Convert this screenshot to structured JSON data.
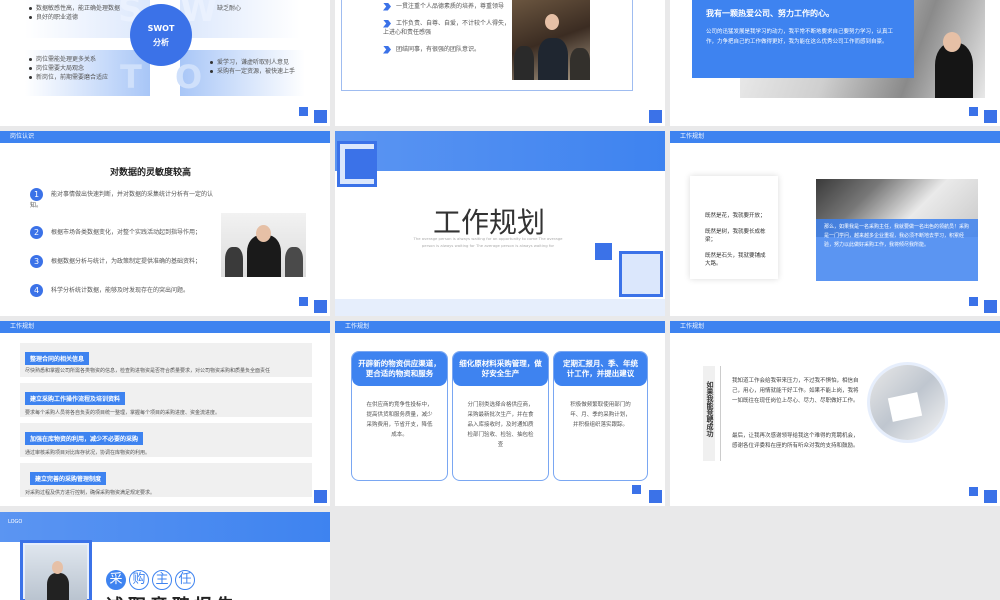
{
  "colors": {
    "accent": "#3e83f0",
    "dark_accent": "#3b72e8",
    "bg": "#e9e9ea"
  },
  "s1": {
    "tl": [
      "数据敏感性高，能正确处理数据",
      "良好的职业道德"
    ],
    "tr": [
      "缺乏耐心"
    ],
    "bl": [
      "岗位需能处理更多关系",
      "岗位需要大局观念",
      "新岗位，前期需要磨合适应"
    ],
    "br": [
      "爱学习，谦虚听取别人意见",
      "采购有一定资源，被快速上手"
    ],
    "center_line1": "SWOT",
    "center_line2": "分析",
    "letter_s": "S",
    "letter_w": "W",
    "letter_t": "T",
    "letter_o": "O"
  },
  "s2": {
    "items": [
      "一贯注重个人品德素质的培养，尊重领导",
      "工作负责、自尊、自爱，不计较个人得失，上进心和责任感强",
      "团结同事，有很强的团队意识。"
    ]
  },
  "s3": {
    "title": "我有一颗热爱公司、努力工作的心。",
    "body": "公司的迅猛发展是我学习的动力，我平常不断地要求自己要努力学习，认真工作，力争把自己的工作做得更好，我为能在这么优秀公司工作而感到自豪。"
  },
  "s4": {
    "tag": "岗位认识",
    "title": "对数据的灵敏度较高",
    "items": [
      {
        "n": "1",
        "t": "能对事情做出快速判断，并对数据的采集统计分析有一定的认知。"
      },
      {
        "n": "2",
        "t": "根据市场各类数据变化，对整个实践活动起到指导作用；"
      },
      {
        "n": "3",
        "t": "根据数据分析与统计，为政策制定提供准确的基础资料；"
      },
      {
        "n": "4",
        "t": "科学分析统计数据，能够及时发现存在的突出问题。"
      }
    ]
  },
  "s5": {
    "title": "工作规划",
    "sub": "The average person is always waiting for an opportunity to come The average person is always waiting for The average person is always waiting for"
  },
  "s6": {
    "tag": "工作规划",
    "lines": [
      "既然是花，我就要开放；",
      "既然是树，我就要长成栋梁；",
      "既然是石头，我就要铺成大路。"
    ],
    "overlay": "那么，如果我是一名采购主任，我就要做一名出色的领航员！采购是一门学问，越来越多企业重视，我必须不断地去学习，积累经验，努力以此做好采购工作，我将倾尽我所能。"
  },
  "s7": {
    "tag": "工作规划",
    "blocks": [
      {
        "h": "整理合同的相关信息",
        "b": "尽快熟悉和掌握公司所需各类物资的信息，检查购进物资是否符合质量要求，对公司物资采购和质量负全面责任"
      },
      {
        "h": "建立采购工作操作流程及培训资料",
        "b": "要求每个采购人员将各自负责的项目统一整理，掌握每个项目的采购进度、资金流进度。"
      },
      {
        "h": "加强在库物资的利用，减少不必要的采购",
        "b": "通过审核采购项目对比库存状况，协调在库物资的利用。"
      },
      {
        "h": "建立完善的采购管理制度",
        "b": "对采购过程及供方进行控制，确保采购物资满足规定要求。"
      }
    ]
  },
  "s8": {
    "tag": "工作规划",
    "cards": [
      {
        "h": "开辟新的物资供应渠道，更合适的物资和服务",
        "b": "在供应商的竞争性投标中，提高供货和服务质量，减少采购费用，节省开支，降低成本。"
      },
      {
        "h": "细化原材料采购管理，做好安全生产",
        "b": "分门别类选择合格供应商，采购最新批次生产，并在食品入库接收时，及时通知质检部门验收、检验、抽包检查"
      },
      {
        "h": "定期汇报月、季、年统计工作，并提出建议",
        "b": "积极做频繁取使用部门的年、月、季的采购计划，并积极组织落实跟踪。"
      }
    ]
  },
  "s9": {
    "tag": "工作规划",
    "vertical": "如果我能竞聘成功",
    "p1": "我知道工作会给我带来压力，不过我不惧怕，相信自己，用心，用情就能干好工作。如果不能上岗，我将一如既往在现任岗位上尽心、尽力、尽职做好工作。",
    "p2": "最后，让我再次感谢领导给我这个难得的竞聘机会，感谢各位评委和在座的所有听众对我的支持和鼓励。"
  },
  "s10": {
    "logo": "LOGO",
    "big": [
      "采",
      "购",
      "主",
      "任"
    ],
    "bottom": "述职竞聘报告"
  }
}
